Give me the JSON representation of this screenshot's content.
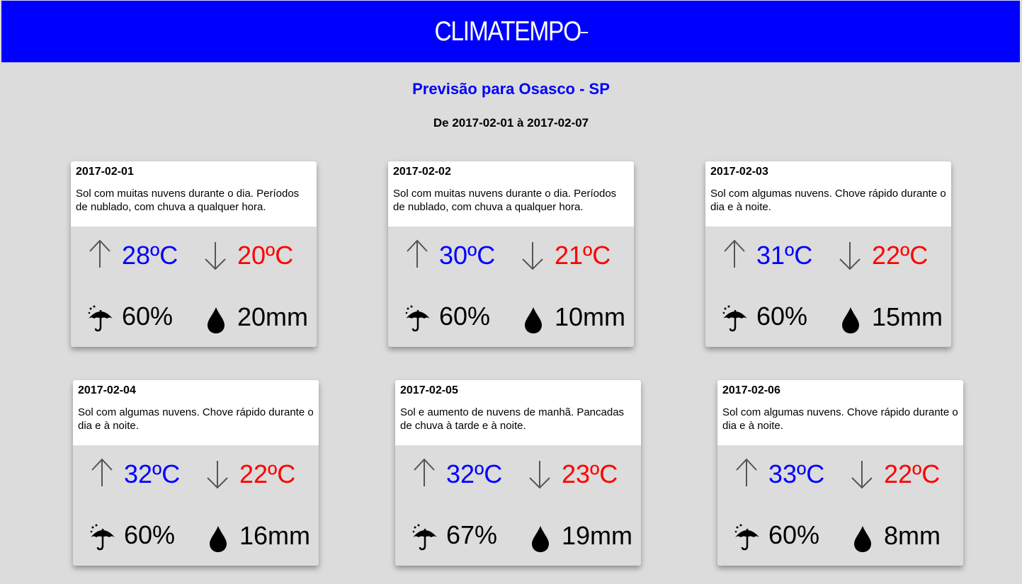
{
  "header": {
    "logo_text": "CLIMATEMPO",
    "background": "#0000ff"
  },
  "page": {
    "title": "Previsão para Osasco - SP",
    "period": "De 2017-02-01 à 2017-02-07"
  },
  "icons": {
    "max": "arrow-up-icon",
    "min": "arrow-down-icon",
    "rain_probability": "umbrella-icon",
    "precipitation": "water-drop-icon"
  },
  "colors": {
    "max_temp": "#0000ff",
    "min_temp": "#ff0000"
  },
  "forecasts": [
    {
      "date": "2017-02-01",
      "description": "Sol com muitas nuvens durante o dia. Períodos de nublado, com chuva a qualquer hora.",
      "max": "28ºC",
      "min": "20ºC",
      "rain_probability": "60%",
      "precipitation": "20mm"
    },
    {
      "date": "2017-02-02",
      "description": "Sol com muitas nuvens durante o dia. Períodos de nublado, com chuva a qualquer hora.",
      "max": "30ºC",
      "min": "21ºC",
      "rain_probability": "60%",
      "precipitation": "10mm"
    },
    {
      "date": "2017-02-03",
      "description": "Sol com algumas nuvens. Chove rápido durante o dia e à noite.",
      "max": "31ºC",
      "min": "22ºC",
      "rain_probability": "60%",
      "precipitation": "15mm"
    },
    {
      "date": "2017-02-04",
      "description": "Sol com algumas nuvens. Chove rápido durante o dia e à noite.",
      "max": "32ºC",
      "min": "22ºC",
      "rain_probability": "60%",
      "precipitation": "16mm"
    },
    {
      "date": "2017-02-05",
      "description": "Sol e aumento de nuvens de manhã. Pancadas de chuva à tarde e à noite.",
      "max": "32ºC",
      "min": "23ºC",
      "rain_probability": "67%",
      "precipitation": "19mm"
    },
    {
      "date": "2017-02-06",
      "description": "Sol com algumas nuvens. Chove rápido durante o dia e à noite.",
      "max": "33ºC",
      "min": "22ºC",
      "rain_probability": "60%",
      "precipitation": "8mm"
    }
  ]
}
